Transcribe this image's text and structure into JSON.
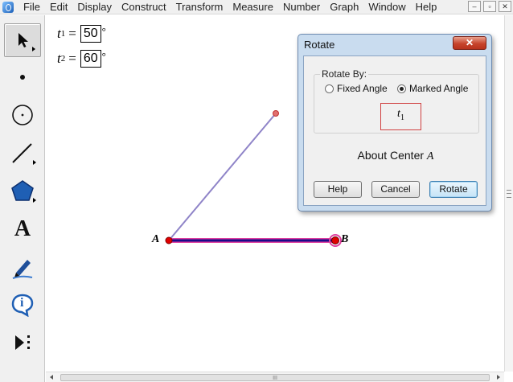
{
  "menubar": {
    "items": [
      "File",
      "Edit",
      "Display",
      "Construct",
      "Transform",
      "Measure",
      "Number",
      "Graph",
      "Window",
      "Help"
    ],
    "window_buttons": [
      "–",
      "▫",
      "✕"
    ]
  },
  "toolbox": {
    "tools": [
      {
        "name": "arrow-tool",
        "icon": "arrow-icon",
        "selected": true
      },
      {
        "name": "point-tool",
        "icon": "point-icon"
      },
      {
        "name": "compass-tool",
        "icon": "circle-icon"
      },
      {
        "name": "straightedge-tool",
        "icon": "line-icon"
      },
      {
        "name": "polygon-tool",
        "icon": "pentagon-icon"
      },
      {
        "name": "text-tool",
        "icon": "text-icon",
        "label": "A"
      },
      {
        "name": "marker-tool",
        "icon": "pen-icon"
      },
      {
        "name": "information-tool",
        "icon": "info-icon",
        "label": "i"
      },
      {
        "name": "custom-tool",
        "icon": "play-more-icon"
      }
    ]
  },
  "canvas": {
    "params": [
      {
        "name": "t",
        "sub": "1",
        "eq": "=",
        "value": "50",
        "unit": "°"
      },
      {
        "name": "t",
        "sub": "2",
        "eq": "=",
        "value": "60",
        "unit": "°"
      }
    ],
    "points": {
      "A": "A",
      "B": "B"
    },
    "colors": {
      "segment_rotated": "#8f84c8",
      "segment_ab": "#1a0a8a",
      "point": "#e00000",
      "selection": "#e040a0"
    }
  },
  "dialog": {
    "title": "Rotate",
    "close_label": "✕",
    "group_label": "Rotate By:",
    "option_fixed": "Fixed Angle",
    "option_marked": "Marked Angle",
    "marked_selected": true,
    "marked_name": "t",
    "marked_sub": "1",
    "about_prefix": "About Center ",
    "about_point": "A",
    "buttons": {
      "help": "Help",
      "cancel": "Cancel",
      "rotate": "Rotate"
    }
  },
  "scroll": {
    "grip": "III"
  }
}
